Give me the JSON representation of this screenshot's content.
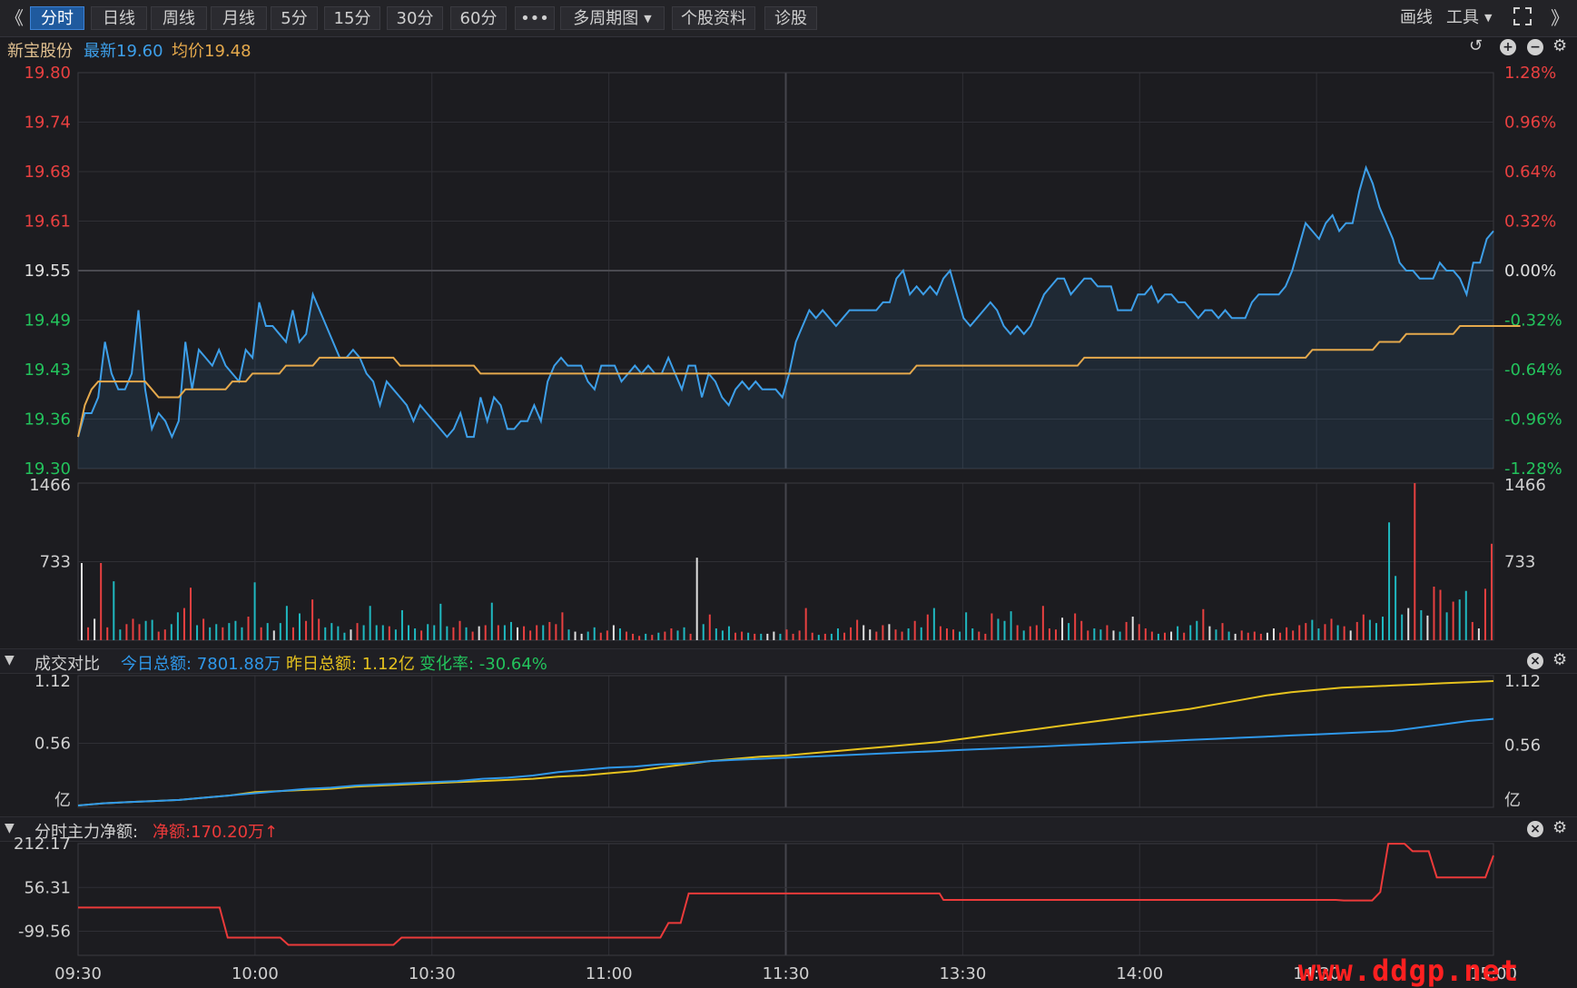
{
  "toolbar": {
    "collapse_icon": "double-chevron-left-icon",
    "expand_icon": "double-chevron-right-icon",
    "tabs": [
      {
        "label": "分时",
        "active": true
      },
      {
        "label": "日线"
      },
      {
        "label": "周线"
      },
      {
        "label": "月线"
      },
      {
        "label": "5分"
      },
      {
        "label": "15分"
      },
      {
        "label": "30分"
      },
      {
        "label": "60分"
      },
      {
        "label": "•••"
      }
    ],
    "multi_period": "多周期图",
    "stock_info": "个股资料",
    "diagnose": "诊股",
    "draw_line": "画线",
    "tools": "工具",
    "fullscreen_icon": "fullscreen-icon"
  },
  "stock": {
    "name": "新宝股份",
    "latest_label": "最新19.60",
    "avg_label": "均价19.48"
  },
  "panel_volume_compare": {
    "title": "成交对比",
    "today_total": "今日总额: 7801.88万",
    "yesterday_total": "昨日总额: 1.12亿",
    "change_rate": "变化率: -30.64%"
  },
  "panel_main_flow": {
    "title": "分时主力净额:",
    "net_amount": "净额:170.20万",
    "arrow": "↑"
  },
  "colors": {
    "price": "#3d9fe9",
    "avg": "#e5a94c",
    "up": "#e84040",
    "down": "#23c35c",
    "neutral": "#e0e0e0",
    "yesterday_amount": "#e6c21e",
    "today_amount": "#2f98ea",
    "flow": "#ec3a3a"
  },
  "watermark": "www.ddgp.net",
  "chart_data": [
    {
      "type": "line",
      "name": "price",
      "x_ticks": [
        "09:30",
        "10:00",
        "10:30",
        "11:00",
        "11:30",
        "13:30",
        "14:00",
        "14:30",
        "15:00"
      ],
      "ylim": [
        19.3,
        19.8
      ],
      "prev_close": 19.55,
      "y_ticks_left": [
        "19.80",
        "19.74",
        "19.68",
        "19.61",
        "19.55",
        "19.49",
        "19.43",
        "19.36",
        "19.30"
      ],
      "y_ticks_right": [
        "1.28%",
        "0.96%",
        "0.64%",
        "0.32%",
        "0.00%",
        "-0.32%",
        "-0.64%",
        "-0.96%",
        "-1.28%"
      ],
      "series": [
        {
          "name": "最新",
          "values": [
            19.34,
            19.37,
            19.37,
            19.39,
            19.46,
            19.42,
            19.4,
            19.4,
            19.42,
            19.5,
            19.4,
            19.35,
            19.37,
            19.36,
            19.34,
            19.36,
            19.46,
            19.4,
            19.45,
            19.44,
            19.43,
            19.45,
            19.43,
            19.42,
            19.41,
            19.45,
            19.44,
            19.51,
            19.48,
            19.48,
            19.47,
            19.46,
            19.5,
            19.46,
            19.47,
            19.52,
            19.5,
            19.48,
            19.46,
            19.44,
            19.44,
            19.45,
            19.44,
            19.42,
            19.41,
            19.38,
            19.41,
            19.4,
            19.39,
            19.38,
            19.36,
            19.38,
            19.37,
            19.36,
            19.35,
            19.34,
            19.35,
            19.37,
            19.34,
            19.34,
            19.39,
            19.36,
            19.39,
            19.38,
            19.35,
            19.35,
            19.36,
            19.36,
            19.38,
            19.36,
            19.41,
            19.43,
            19.44,
            19.43,
            19.43,
            19.43,
            19.41,
            19.4,
            19.43,
            19.43,
            19.43,
            19.41,
            19.42,
            19.43,
            19.42,
            19.43,
            19.42,
            19.42,
            19.44,
            19.42,
            19.4,
            19.43,
            19.43,
            19.39,
            19.42,
            19.41,
            19.39,
            19.38,
            19.4,
            19.41,
            19.4,
            19.41,
            19.4,
            19.4,
            19.4,
            19.39,
            19.42,
            19.46,
            19.48,
            19.5,
            19.49,
            19.5,
            19.49,
            19.48,
            19.49,
            19.5,
            19.5,
            19.5,
            19.5,
            19.5,
            19.51,
            19.51,
            19.54,
            19.55,
            19.52,
            19.53,
            19.52,
            19.53,
            19.52,
            19.54,
            19.55,
            19.52,
            19.49,
            19.48,
            19.49,
            19.5,
            19.51,
            19.5,
            19.48,
            19.47,
            19.48,
            19.47,
            19.48,
            19.5,
            19.52,
            19.53,
            19.54,
            19.54,
            19.52,
            19.53,
            19.54,
            19.54,
            19.53,
            19.53,
            19.53,
            19.5,
            19.5,
            19.5,
            19.52,
            19.52,
            19.53,
            19.51,
            19.52,
            19.52,
            19.51,
            19.51,
            19.5,
            19.49,
            19.5,
            19.5,
            19.49,
            19.5,
            19.49,
            19.49,
            19.49,
            19.51,
            19.52,
            19.52,
            19.52,
            19.52,
            19.53,
            19.55,
            19.58,
            19.61,
            19.6,
            19.59,
            19.61,
            19.62,
            19.6,
            19.61,
            19.61,
            19.65,
            19.68,
            19.66,
            19.63,
            19.61,
            19.59,
            19.56,
            19.55,
            19.55,
            19.54,
            19.54,
            19.54,
            19.56,
            19.55,
            19.55,
            19.54,
            19.52,
            19.56,
            19.56,
            19.59,
            19.6
          ]
        },
        {
          "name": "均价",
          "values": [
            19.34,
            19.38,
            19.4,
            19.41,
            19.41,
            19.41,
            19.41,
            19.41,
            19.41,
            19.41,
            19.41,
            19.4,
            19.39,
            19.39,
            19.39,
            19.39,
            19.4,
            19.4,
            19.4,
            19.4,
            19.4,
            19.4,
            19.4,
            19.41,
            19.41,
            19.41,
            19.42,
            19.42,
            19.42,
            19.42,
            19.42,
            19.43,
            19.43,
            19.43,
            19.43,
            19.43,
            19.44,
            19.44,
            19.44,
            19.44,
            19.44,
            19.44,
            19.44,
            19.44,
            19.44,
            19.44,
            19.44,
            19.44,
            19.43,
            19.43,
            19.43,
            19.43,
            19.43,
            19.43,
            19.43,
            19.43,
            19.43,
            19.43,
            19.43,
            19.43,
            19.42,
            19.42,
            19.42,
            19.42,
            19.42,
            19.42,
            19.42,
            19.42,
            19.42,
            19.42,
            19.42,
            19.42,
            19.42,
            19.42,
            19.42,
            19.42,
            19.42,
            19.42,
            19.42,
            19.42,
            19.42,
            19.42,
            19.42,
            19.42,
            19.42,
            19.42,
            19.42,
            19.42,
            19.42,
            19.42,
            19.42,
            19.42,
            19.42,
            19.42,
            19.42,
            19.42,
            19.42,
            19.42,
            19.42,
            19.42,
            19.42,
            19.42,
            19.42,
            19.42,
            19.42,
            19.42,
            19.42,
            19.42,
            19.42,
            19.42,
            19.42,
            19.42,
            19.42,
            19.42,
            19.42,
            19.42,
            19.42,
            19.42,
            19.42,
            19.42,
            19.42,
            19.42,
            19.42,
            19.42,
            19.42,
            19.43,
            19.43,
            19.43,
            19.43,
            19.43,
            19.43,
            19.43,
            19.43,
            19.43,
            19.43,
            19.43,
            19.43,
            19.43,
            19.43,
            19.43,
            19.43,
            19.43,
            19.43,
            19.43,
            19.43,
            19.43,
            19.43,
            19.43,
            19.43,
            19.43,
            19.44,
            19.44,
            19.44,
            19.44,
            19.44,
            19.44,
            19.44,
            19.44,
            19.44,
            19.44,
            19.44,
            19.44,
            19.44,
            19.44,
            19.44,
            19.44,
            19.44,
            19.44,
            19.44,
            19.44,
            19.44,
            19.44,
            19.44,
            19.44,
            19.44,
            19.44,
            19.44,
            19.44,
            19.44,
            19.44,
            19.44,
            19.44,
            19.44,
            19.44,
            19.45,
            19.45,
            19.45,
            19.45,
            19.45,
            19.45,
            19.45,
            19.45,
            19.45,
            19.45,
            19.46,
            19.46,
            19.46,
            19.46,
            19.47,
            19.47,
            19.47,
            19.47,
            19.47,
            19.47,
            19.47,
            19.47,
            19.48,
            19.48,
            19.48,
            19.48,
            19.48,
            19.48,
            19.48,
            19.48,
            19.48,
            19.48
          ]
        }
      ]
    },
    {
      "type": "bar",
      "name": "volume",
      "ylim": [
        0,
        1466
      ],
      "y_ticks": [
        "1466",
        "733"
      ],
      "values": [
        720,
        120,
        200,
        720,
        120,
        550,
        100,
        150,
        200,
        150,
        180,
        190,
        80,
        100,
        150,
        260,
        300,
        490,
        140,
        200,
        120,
        150,
        120,
        160,
        180,
        120,
        220,
        540,
        120,
        160,
        90,
        160,
        320,
        120,
        250,
        180,
        380,
        200,
        120,
        160,
        130,
        70,
        100,
        160,
        140,
        320,
        140,
        140,
        130,
        100,
        280,
        140,
        110,
        90,
        150,
        140,
        340,
        130,
        120,
        180,
        120,
        80,
        130,
        140,
        350,
        140,
        140,
        170,
        120,
        130,
        90,
        140,
        140,
        170,
        150,
        260,
        100,
        80,
        60,
        80,
        120,
        70,
        90,
        140,
        110,
        80,
        60,
        40,
        60,
        50,
        70,
        80,
        110,
        90,
        120,
        60,
        770,
        150,
        240,
        110,
        90,
        130,
        70,
        80,
        70,
        60,
        60,
        60,
        80,
        60,
        100,
        60,
        90,
        300,
        70,
        50,
        60,
        60,
        110,
        70,
        120,
        190,
        140,
        100,
        80,
        140,
        150,
        100,
        80,
        110,
        180,
        120,
        240,
        300,
        130,
        110,
        100,
        80,
        260,
        110,
        80,
        60,
        250,
        200,
        180,
        270,
        140,
        90,
        130,
        140,
        320,
        110,
        100,
        210,
        160,
        250,
        180,
        90,
        110,
        100,
        140,
        90,
        80,
        170,
        220,
        150,
        110,
        80,
        60,
        70,
        80,
        130,
        70,
        140,
        180,
        290,
        130,
        100,
        160,
        80,
        60,
        90,
        70,
        80,
        60,
        70,
        110,
        70,
        120,
        90,
        140,
        160,
        190,
        110,
        150,
        200,
        140,
        130,
        90,
        170,
        240,
        190,
        160,
        220,
        1100,
        600,
        240,
        300,
        1466,
        280,
        230,
        500,
        470,
        260,
        360,
        380,
        460,
        170,
        110,
        480,
        900
      ],
      "colors": "by price tick direction (red up, green down, white flat)"
    },
    {
      "type": "line",
      "name": "成交对比",
      "ylim": [
        0,
        1.12
      ],
      "y_ticks": [
        "1.12",
        "0.56",
        "亿"
      ],
      "series": [
        {
          "name": "昨日总额",
          "values": [
            0.0,
            0.02,
            0.03,
            0.04,
            0.05,
            0.07,
            0.09,
            0.12,
            0.13,
            0.14,
            0.15,
            0.17,
            0.18,
            0.19,
            0.2,
            0.21,
            0.22,
            0.23,
            0.24,
            0.26,
            0.27,
            0.29,
            0.31,
            0.34,
            0.37,
            0.4,
            0.42,
            0.44,
            0.45,
            0.47,
            0.49,
            0.51,
            0.53,
            0.55,
            0.57,
            0.6,
            0.63,
            0.66,
            0.69,
            0.72,
            0.75,
            0.78,
            0.81,
            0.84,
            0.87,
            0.91,
            0.95,
            0.99,
            1.02,
            1.04,
            1.06,
            1.07,
            1.08,
            1.09,
            1.1,
            1.11,
            1.12
          ]
        },
        {
          "name": "今日总额",
          "values": [
            0.0,
            0.02,
            0.03,
            0.04,
            0.05,
            0.07,
            0.09,
            0.11,
            0.13,
            0.15,
            0.16,
            0.18,
            0.19,
            0.2,
            0.21,
            0.22,
            0.24,
            0.25,
            0.27,
            0.3,
            0.32,
            0.34,
            0.35,
            0.37,
            0.38,
            0.4,
            0.41,
            0.42,
            0.43,
            0.44,
            0.45,
            0.46,
            0.47,
            0.48,
            0.49,
            0.5,
            0.51,
            0.52,
            0.53,
            0.54,
            0.55,
            0.56,
            0.57,
            0.58,
            0.59,
            0.6,
            0.61,
            0.62,
            0.63,
            0.64,
            0.65,
            0.66,
            0.67,
            0.7,
            0.73,
            0.76,
            0.78
          ]
        }
      ]
    },
    {
      "type": "line",
      "name": "分时主力净额",
      "ylim": [
        -185,
        212.17
      ],
      "y_ticks": [
        "212.17",
        "56.31",
        "-99.56"
      ],
      "steps": [
        {
          "t": 0,
          "v": -15
        },
        {
          "t": 35,
          "v": -15
        },
        {
          "t": 37,
          "v": -122
        },
        {
          "t": 50,
          "v": -122
        },
        {
          "t": 52,
          "v": -148
        },
        {
          "t": 78,
          "v": -148
        },
        {
          "t": 80,
          "v": -122
        },
        {
          "t": 144,
          "v": -122
        },
        {
          "t": 146,
          "v": -70
        },
        {
          "t": 149,
          "v": -70
        },
        {
          "t": 151,
          "v": 35
        },
        {
          "t": 213,
          "v": 35
        },
        {
          "t": 214,
          "v": 12
        },
        {
          "t": 311,
          "v": 12
        },
        {
          "t": 313,
          "v": 10
        },
        {
          "t": 320,
          "v": 10
        },
        {
          "t": 322,
          "v": 40
        },
        {
          "t": 324,
          "v": 212
        },
        {
          "t": 328,
          "v": 212
        },
        {
          "t": 330,
          "v": 185
        },
        {
          "t": 334,
          "v": 185
        },
        {
          "t": 336,
          "v": 92
        },
        {
          "t": 348,
          "v": 92
        },
        {
          "t": 350,
          "v": 170
        }
      ],
      "t_max": 350
    }
  ]
}
